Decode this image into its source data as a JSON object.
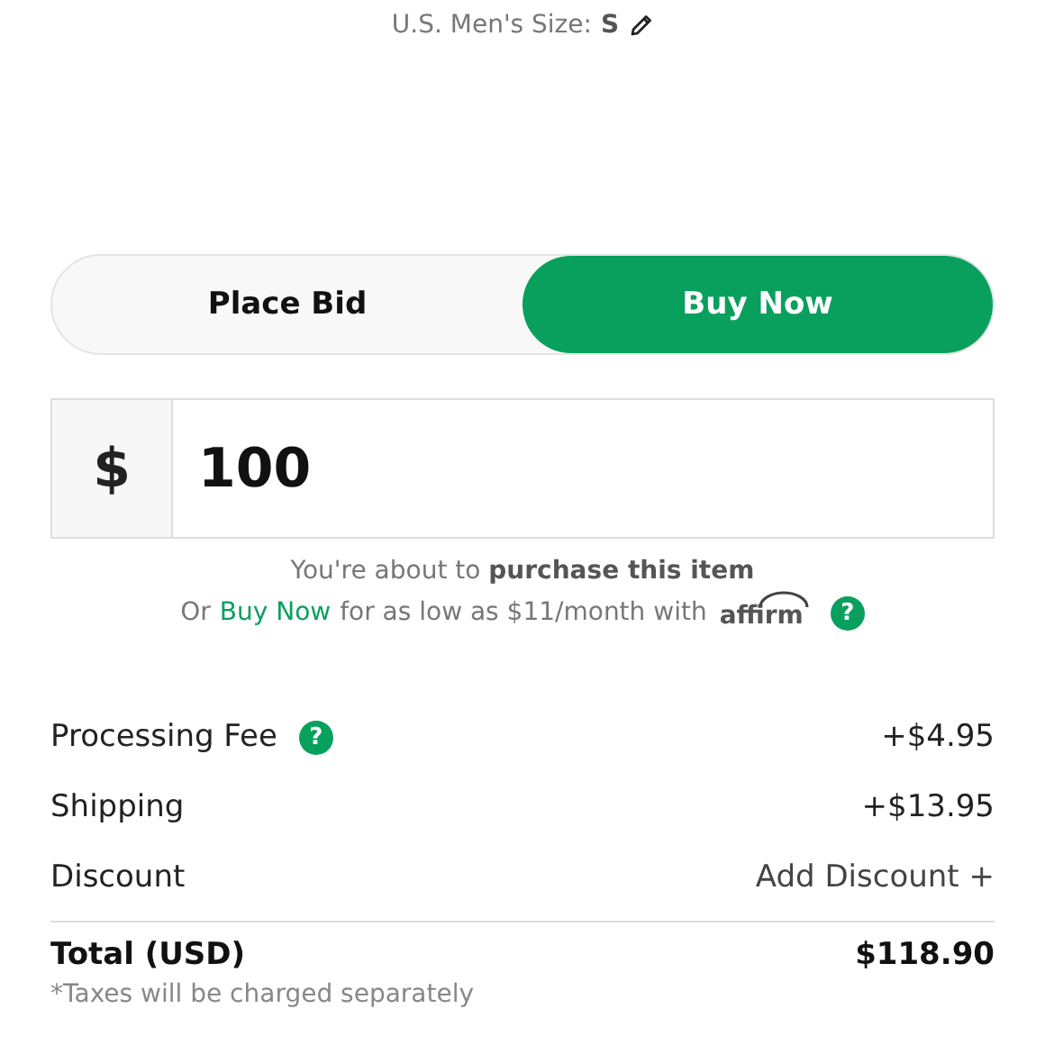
{
  "size": {
    "label": "U.S. Men's Size:",
    "value": "S"
  },
  "tabs": [
    {
      "label": "Place Bid",
      "selected": false
    },
    {
      "label": "Buy Now",
      "selected": true
    }
  ],
  "amount": {
    "currency": "$",
    "value": "100"
  },
  "notice": "You're about to **purchase this item**",
  "financing": {
    "prefix": "Or",
    "link": "Buy Now",
    "text": "for as low as $11/month with",
    "brand": "affirm",
    "help": "?"
  },
  "lines": [
    {
      "kind": "fee",
      "label": "Processing Fee",
      "help": "?",
      "value": "+$4.95"
    },
    {
      "kind": "fee",
      "label": "Shipping",
      "value": "+$13.95"
    },
    {
      "kind": "action",
      "label": "Discount",
      "value": "Add Discount +"
    }
  ],
  "total": {
    "label": "Total (USD)",
    "value": "$118.90"
  },
  "note": "*Taxes will be charged separately"
}
